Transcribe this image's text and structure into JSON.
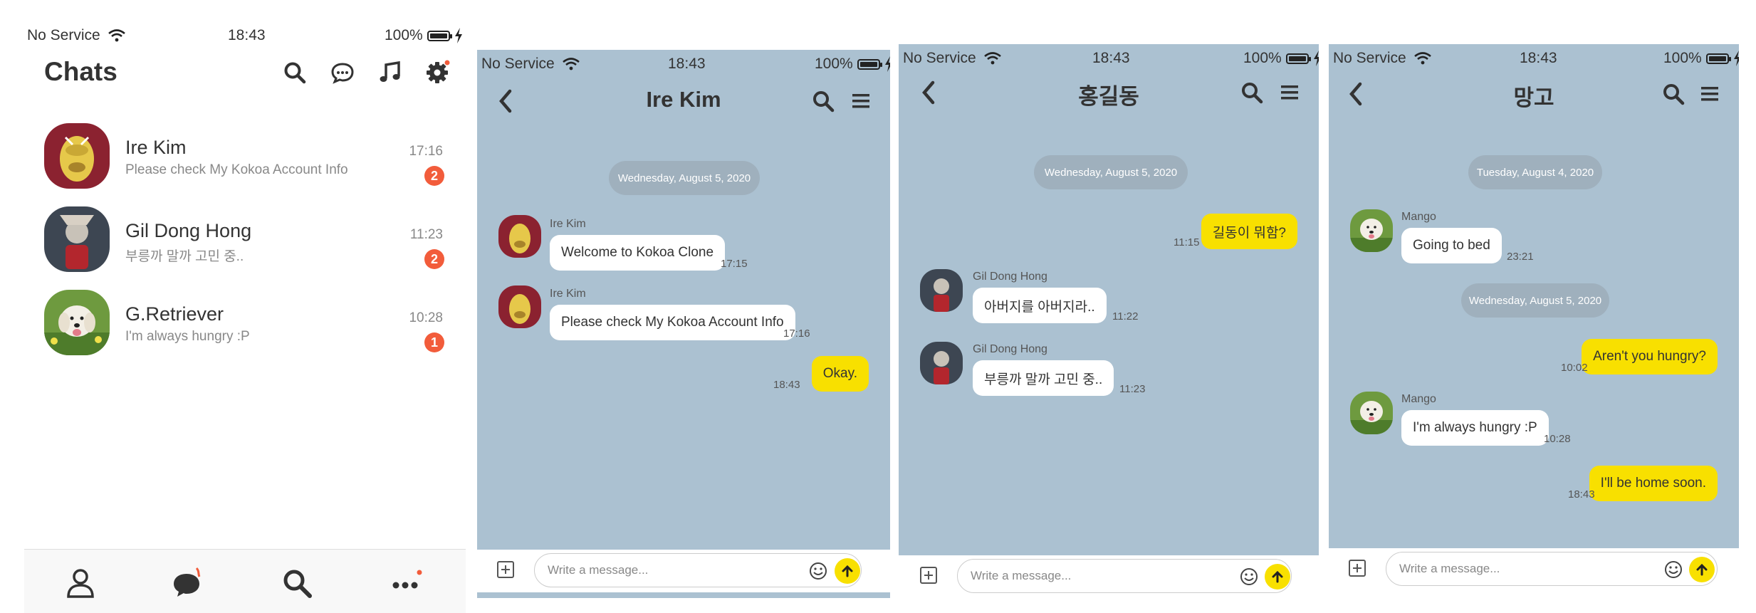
{
  "colors": {
    "chat_bg": "#abc1d1",
    "badge": "#f25c3b",
    "outgoing_bubble": "#f8e000",
    "incoming_bubble": "#ffffff",
    "date_pill": "#9fb0bd"
  },
  "status": {
    "carrier": "No Service",
    "time": "18:43",
    "battery": "100%"
  },
  "chats_screen": {
    "title": "Chats",
    "header_icons": [
      "search-icon",
      "chat-bubble-icon",
      "music-note-icon",
      "gear-icon"
    ],
    "chats": [
      {
        "name": "Ire Kim",
        "preview": "Please check My Kokoa Account Info",
        "time": "17:16",
        "badge": "2"
      },
      {
        "name": "Gil Dong Hong",
        "preview": "부릉까 말까 고민 중..",
        "time": "11:23",
        "badge": "2"
      },
      {
        "name": "G.Retriever",
        "preview": "I'm always hungry :P",
        "time": "10:28",
        "badge": "1"
      }
    ],
    "tabs": [
      "profile-icon",
      "chats-icon",
      "search-icon",
      "more-icon"
    ]
  },
  "chat1": {
    "title": "Ire Kim",
    "date": "Wednesday, August 5, 2020",
    "messages": [
      {
        "sender": "Ire Kim",
        "text": "Welcome to Kokoa Clone",
        "time": "17:15"
      },
      {
        "sender": "Ire Kim",
        "text": "Please check My Kokoa Account Info",
        "time": "17:16"
      },
      {
        "text": "Okay.",
        "time": "18:43"
      }
    ],
    "placeholder": "Write a message..."
  },
  "chat2": {
    "title": "홍길동",
    "date": "Wednesday, August 5, 2020",
    "messages": [
      {
        "text": "길동이 뭐함?",
        "time": "11:15"
      },
      {
        "sender": "Gil Dong Hong",
        "text": "아버지를 아버지라..",
        "time": "11:22"
      },
      {
        "sender": "Gil Dong Hong",
        "text": "부릉까 말까 고민 중..",
        "time": "11:23"
      }
    ],
    "placeholder": "Write a message..."
  },
  "chat3": {
    "title": "망고",
    "date1": "Tuesday, August 4, 2020",
    "date2": "Wednesday, August 5, 2020",
    "messages": [
      {
        "sender": "Mango",
        "text": "Going to bed",
        "time": "23:21"
      },
      {
        "text": "Aren't you hungry?",
        "time": "10:02"
      },
      {
        "sender": "Mango",
        "text": "I'm always hungry :P",
        "time": "10:28"
      },
      {
        "text": "I'll be home soon.",
        "time": "18:43"
      }
    ],
    "placeholder": "Write a message..."
  }
}
